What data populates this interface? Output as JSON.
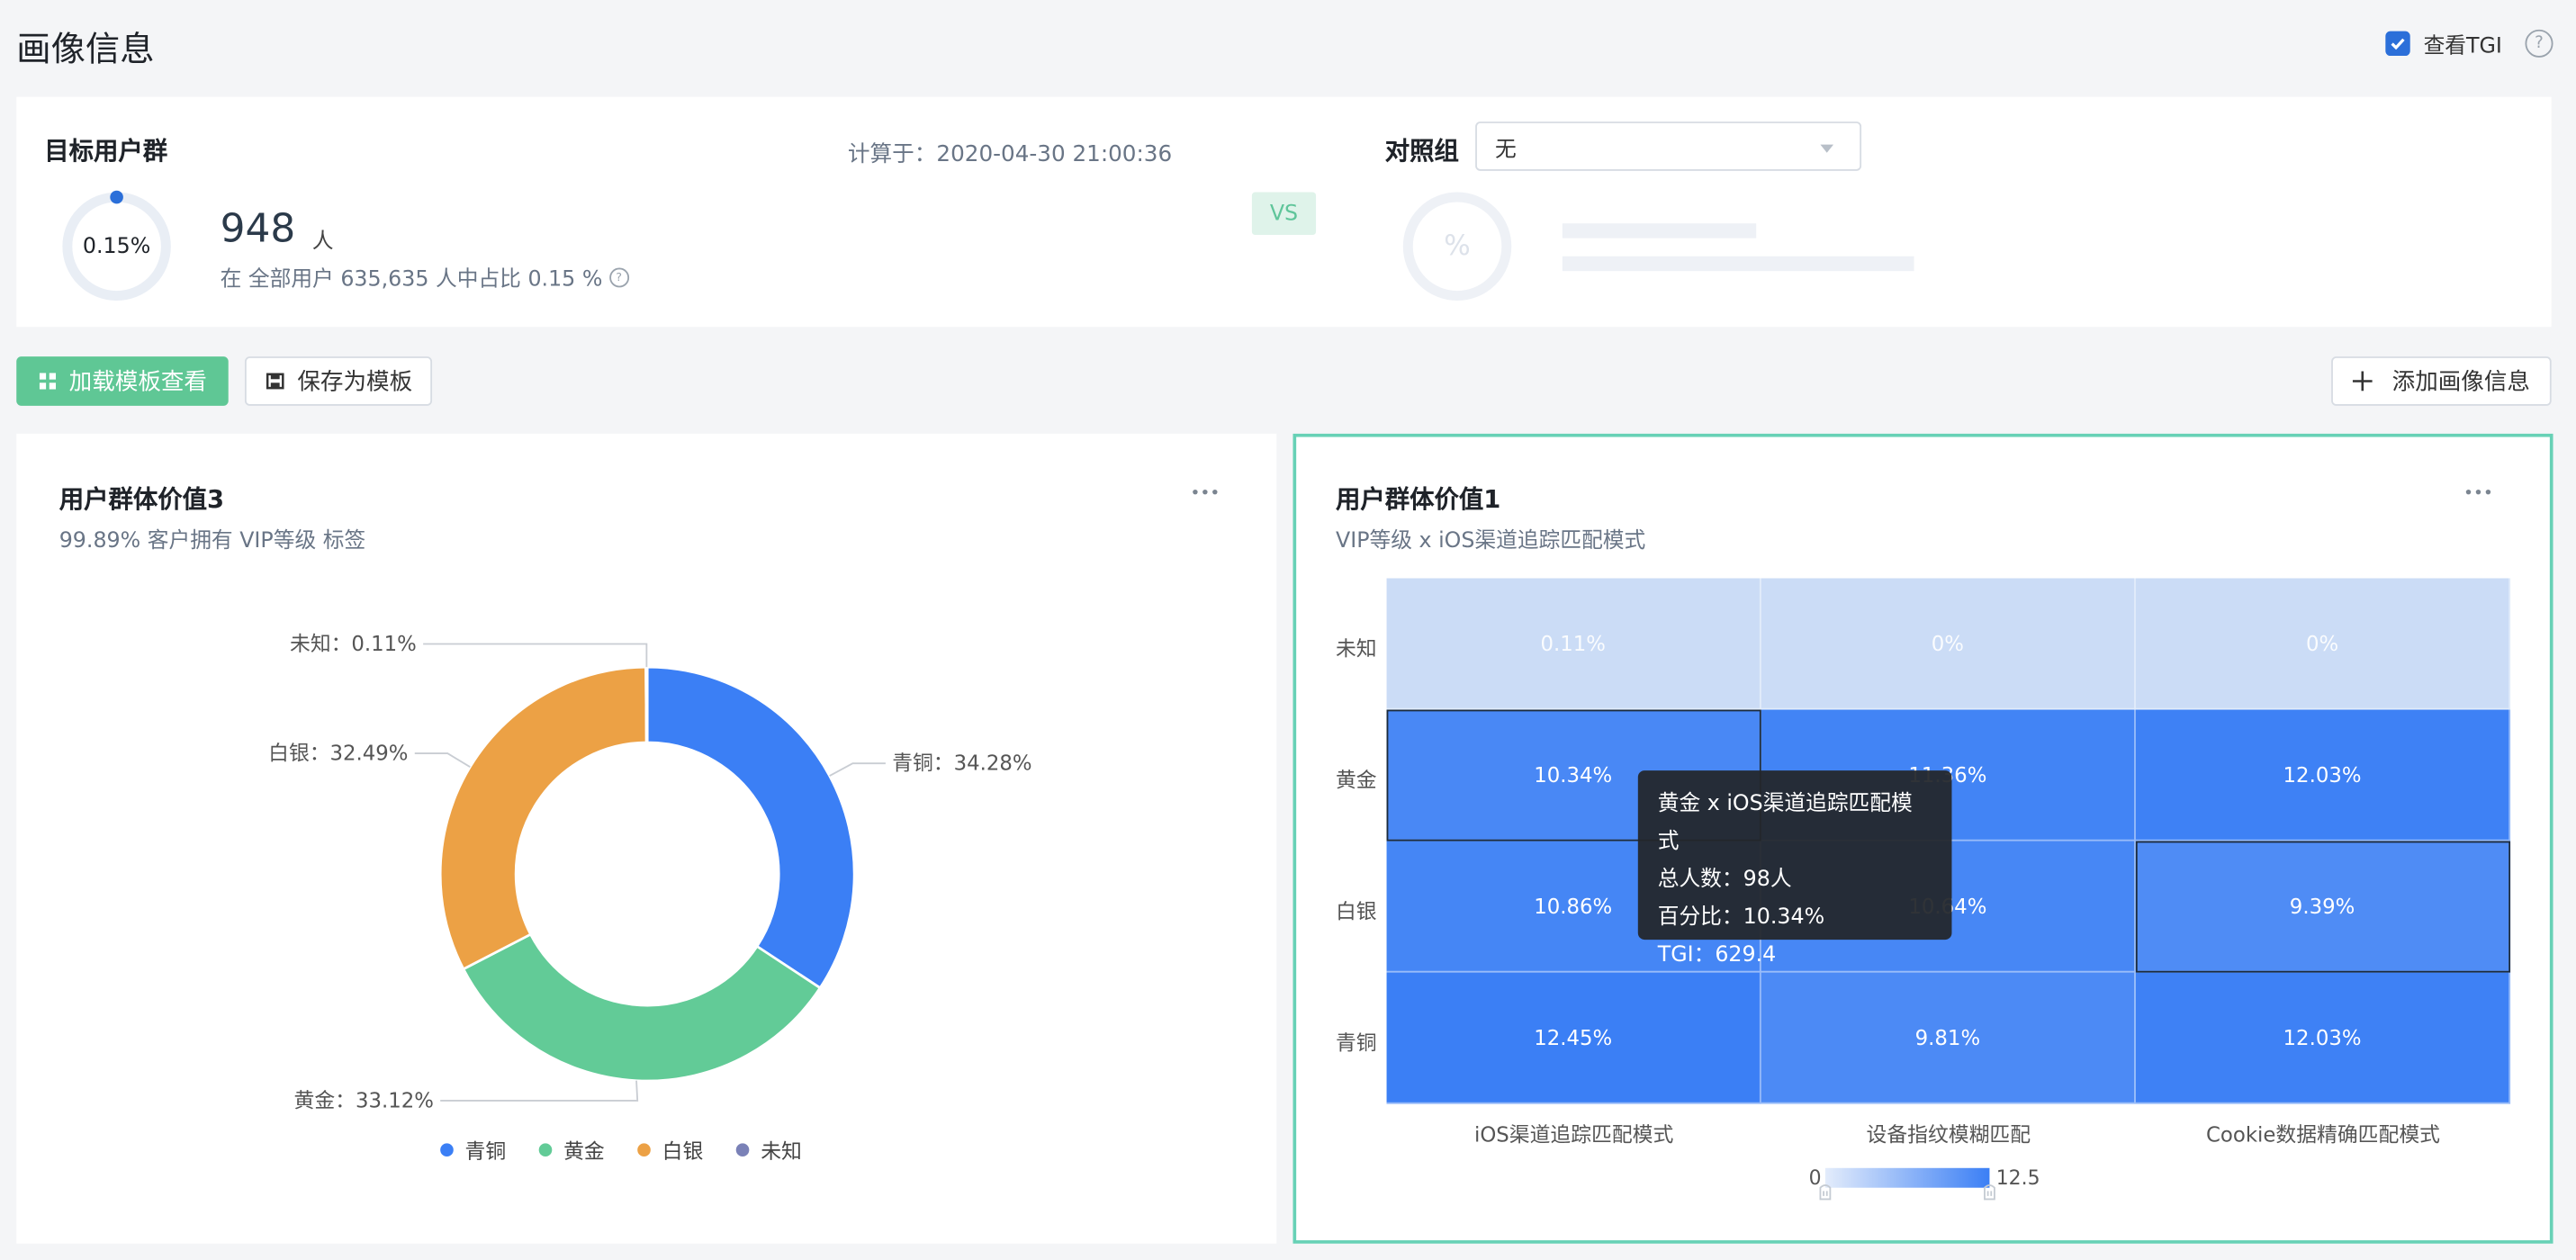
{
  "page": {
    "title": "画像信息"
  },
  "tgi": {
    "label": "查看TGI",
    "checked": true
  },
  "summary": {
    "target_title": "目标用户群",
    "ring_pct": "0.15%",
    "count": "948",
    "unit": "人",
    "pct_text": "在 全部用户 635,635 人中占比 0.15 %",
    "calc_time": "计算于：2020-04-30 21:00:36",
    "vs": "VS",
    "compare_title": "对照组",
    "compare_value": "无",
    "ghost_pct": "%"
  },
  "toolbar": {
    "load_template": "加载模板查看",
    "save_template": "保存为模板",
    "add_info": "添加画像信息"
  },
  "left_panel": {
    "title": "用户群体价值3",
    "subtitle": "99.89% 客户拥有 VIP等级 标签"
  },
  "right_panel": {
    "title": "用户群体价值1",
    "subtitle": "VIP等级 x iOS渠道追踪匹配模式"
  },
  "colors": {
    "bronze": "#3b7ff5",
    "gold": "#62cb97",
    "silver": "#eca145",
    "unknown": "#7a81b7",
    "accent_green": "#5fc795",
    "heat_low": "#cbdcf6",
    "heat_high": "#3b7ff5"
  },
  "chart_data": [
    {
      "type": "pie",
      "donut": true,
      "slices": [
        {
          "name": "青铜",
          "value": 34.28,
          "label": "青铜：34.28%",
          "color": "#3b7ff5"
        },
        {
          "name": "黄金",
          "value": 33.12,
          "label": "黄金：33.12%",
          "color": "#62cb97"
        },
        {
          "name": "白银",
          "value": 32.49,
          "label": "白银：32.49%",
          "color": "#eca145"
        },
        {
          "name": "未知",
          "value": 0.11,
          "label": "未知：0.11%",
          "color": "#7a81b7"
        }
      ],
      "legend": [
        "青铜",
        "黄金",
        "白银",
        "未知"
      ],
      "legend_position": "bottom"
    },
    {
      "type": "heatmap",
      "rows": [
        "未知",
        "黄金",
        "白银",
        "青铜"
      ],
      "columns": [
        "iOS渠道追踪匹配模式",
        "设备指纹模糊匹配",
        "Cookie数据精确匹配模式"
      ],
      "values": [
        [
          0.11,
          0,
          0
        ],
        [
          10.34,
          11.36,
          12.03
        ],
        [
          10.86,
          10.64,
          9.39
        ],
        [
          12.45,
          9.81,
          12.03
        ]
      ],
      "labels": [
        [
          "0.11%",
          "0%",
          "0%"
        ],
        [
          "10.34%",
          "11.36%",
          "12.03%"
        ],
        [
          "10.86%",
          "10.64%",
          "9.39%"
        ],
        [
          "12.45%",
          "9.81%",
          "12.03%"
        ]
      ],
      "visual_map": {
        "min": 0,
        "max": 12.5,
        "min_label": "0",
        "max_label": "12.5"
      },
      "highlighted": [
        [
          "黄金",
          "iOS渠道追踪匹配模式"
        ],
        [
          "白银",
          "Cookie数据精确匹配模式"
        ]
      ],
      "tooltip": {
        "title": "黄金 x iOS渠道追踪匹配模式",
        "lines": [
          "总人数：98人",
          "百分比：10.34%",
          "TGI：629.4"
        ]
      }
    }
  ]
}
